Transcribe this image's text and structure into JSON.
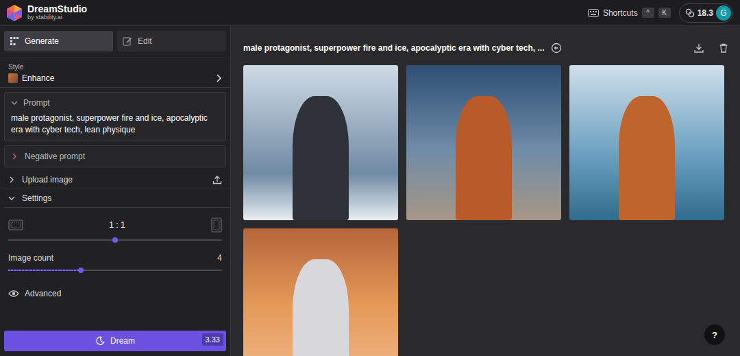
{
  "app": {
    "name": "DreamStudio",
    "byline": "by stability.ai"
  },
  "header": {
    "shortcuts": {
      "label": "Shortcuts",
      "keys": [
        "^",
        "K"
      ]
    },
    "credits": "18.3",
    "avatar": "G"
  },
  "tabs": [
    {
      "label": "Generate",
      "selected": true
    },
    {
      "label": "Edit",
      "selected": false
    }
  ],
  "style": {
    "label": "Style",
    "value": "Enhance"
  },
  "prompt": {
    "label": "Prompt",
    "expanded": true,
    "text": "male protagonist, superpower fire and ice, apocalyptic era with cyber tech, lean physique"
  },
  "sections": [
    {
      "label": "Negative prompt",
      "expanded": false,
      "kind": "field"
    },
    {
      "label": "Upload image",
      "expanded": false,
      "kind": "upload"
    }
  ],
  "settings": {
    "label": "Settings",
    "expanded": true,
    "aspect": {
      "value": "1 : 1",
      "level": 0.5
    },
    "image_count": {
      "label": "Image count",
      "value": "4",
      "level": 0.34
    },
    "advanced": "Advanced"
  },
  "dream_button": {
    "label": "Dream",
    "cost": "3.33"
  },
  "gallery": {
    "title": "male protagonist, superpower fire and ice, apocalyptic era with cyber tech, ...",
    "images": [
      {},
      {},
      {},
      {}
    ]
  },
  "help": "?"
}
